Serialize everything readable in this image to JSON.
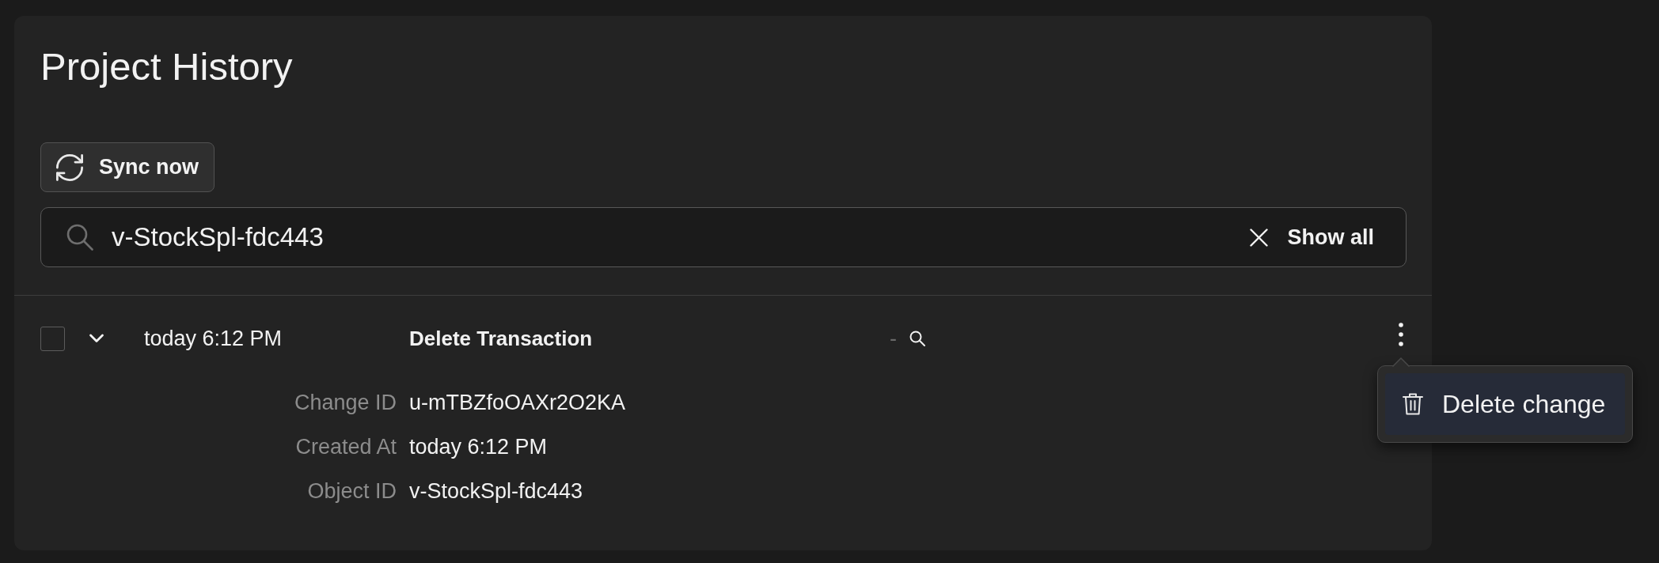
{
  "page": {
    "title": "Project History"
  },
  "toolbar": {
    "sync_button": "Sync now"
  },
  "search": {
    "value": "v-StockSpl-fdc443",
    "clear_button": "Show all"
  },
  "history": [
    {
      "checked": false,
      "expanded": true,
      "time": "today 6:12 PM",
      "action": "Delete Transaction",
      "column_3": "-",
      "details": [
        {
          "label": "Change ID",
          "value": "u-mTBZfoOAXr2O2KA"
        },
        {
          "label": "Created At",
          "value": "today 6:12 PM"
        },
        {
          "label": "Object ID",
          "value": "v-StockSpl-fdc443"
        }
      ]
    }
  ],
  "context_menu": {
    "open": true,
    "items": [
      {
        "label": "Delete change",
        "highlighted": true
      }
    ]
  }
}
